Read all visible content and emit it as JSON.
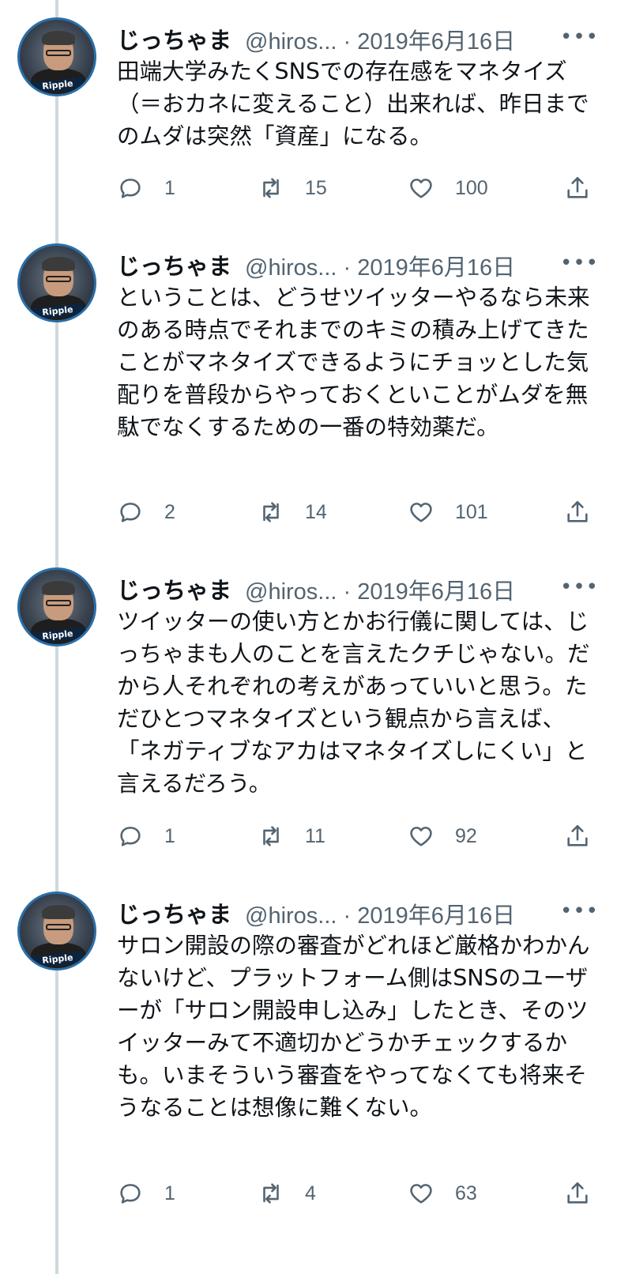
{
  "tweets": [
    {
      "author": "じっちゃま",
      "handle_date": "@hiros... · 2019年6月16日",
      "avatar_label": "Ripple",
      "text": "田端大学みたくSNSでの存在感をマネタイズ（＝おカネに変えること）出来れば、昨日までのムダは突然「資産」になる。",
      "replies": "1",
      "retweets": "15",
      "likes": "100"
    },
    {
      "author": "じっちゃま",
      "handle_date": "@hiros... · 2019年6月16日",
      "avatar_label": "Ripple",
      "text": "ということは、どうせツイッターやるなら未来のある時点でそれまでのキミの積み上げてきたことがマネタイズできるようにチョッとした気配りを普段からやっておくといことがムダを無駄でなくするための一番の特効薬だ。",
      "replies": "2",
      "retweets": "14",
      "likes": "101"
    },
    {
      "author": "じっちゃま",
      "handle_date": "@hiros... · 2019年6月16日",
      "avatar_label": "Ripple",
      "text": "ツイッターの使い方とかお行儀に関しては、じっちゃまも人のことを言えたクチじゃない。だから人それぞれの考えがあっていいと思う。ただひとつマネタイズという観点から言えば、「ネガティブなアカはマネタイズしにくい」と言えるだろう。",
      "replies": "1",
      "retweets": "11",
      "likes": "92"
    },
    {
      "author": "じっちゃま",
      "handle_date": "@hiros... · 2019年6月16日",
      "avatar_label": "Ripple",
      "text": "サロン開設の際の審査がどれほど厳格かわかんないけど、プラットフォーム側はSNSのユーザーが「サロン開設申し込み」したとき、そのツイッターみて不適切かどうかチェックするかも。いまそういう審査をやってなくても将来そうなることは想像に難くない。",
      "replies": "1",
      "retweets": "4",
      "likes": "63"
    }
  ]
}
